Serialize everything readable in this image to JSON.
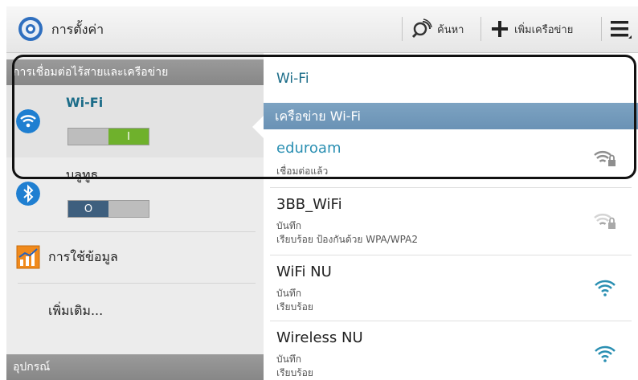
{
  "header": {
    "title": "การตั้งค่า",
    "search_label": "ค้นหา",
    "add_network_label": "เพิ่มเครือข่าย"
  },
  "sidebar": {
    "section_wireless": "การเชื่อมต่อไร้สายและเครือข่าย",
    "wifi": {
      "label": "Wi-Fi",
      "state": "on",
      "toggle_on_glyph": "I"
    },
    "bluetooth": {
      "label": "บลูทูธ",
      "state": "off",
      "toggle_off_glyph": "O"
    },
    "data_usage": {
      "label": "การใช้ข้อมูล"
    },
    "more": {
      "label": "เพิ่มเติม..."
    },
    "section_device": "อุปกรณ์"
  },
  "main": {
    "title": "Wi-Fi",
    "subheader": "เครือข่าย Wi-Fi",
    "networks": [
      {
        "name": "eduroam",
        "line1": "เชื่อมต่อแล้ว",
        "line2": "",
        "icon": "wifi-lock-icon",
        "status": "connected"
      },
      {
        "name": "3BB_WiFi",
        "line1": "บันทึก",
        "line2": "เรียบร้อย ป้องกันด้วย WPA/WPA2",
        "icon": "wifi-lock-icon",
        "status": "weak"
      },
      {
        "name": "WiFi NU",
        "line1": "บันทึก",
        "line2": "เรียบร้อย",
        "icon": "wifi-icon",
        "status": "open"
      },
      {
        "name": "Wireless NU",
        "line1": "บันทึก",
        "line2": "เรียบร้อย",
        "icon": "wifi-icon",
        "status": "open"
      }
    ]
  },
  "colors": {
    "accent_teal": "#2a8fb2",
    "toggle_on": "#6fb12c",
    "toggle_off": "#3e5f7e",
    "section_header": "#8e8e8e",
    "subheader_blue": "#6f96b8"
  }
}
